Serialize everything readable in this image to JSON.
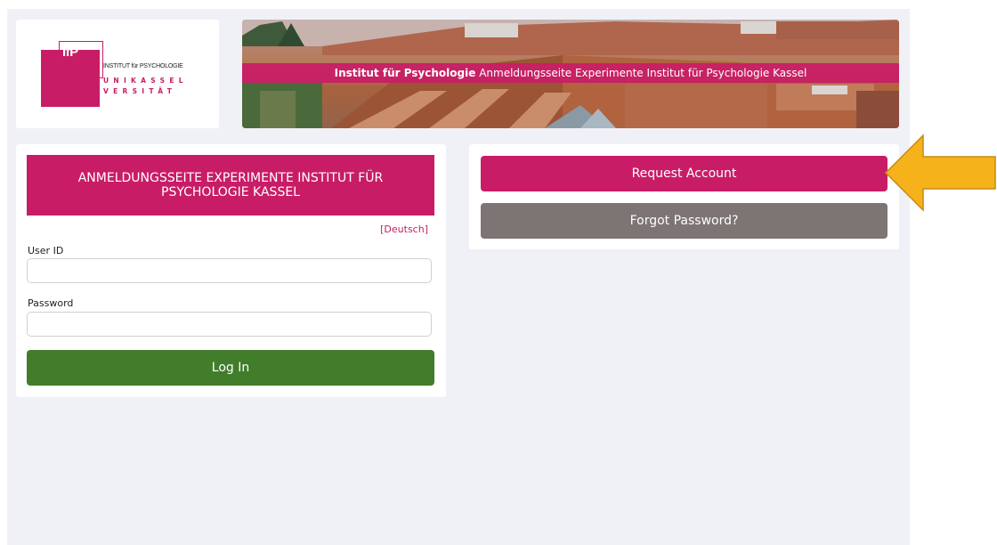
{
  "logo": {
    "mark": "IfP",
    "institute": "INSTITUT für PSYCHOLOGIE",
    "uni_line1": "UNIKASSEL",
    "uni_line2": "VERSITÄT"
  },
  "banner": {
    "title_bold": "Institut für Psychologie",
    "title_rest": "Anmeldungsseite Experimente Institut für Psychologie Kassel"
  },
  "login": {
    "header": "ANMELDUNGSSEITE EXPERIMENTE INSTITUT FÜR PSYCHOLOGIE KASSEL",
    "language_link": "[Deutsch]",
    "user_id_label": "User ID",
    "user_id_value": "",
    "password_label": "Password",
    "password_value": "",
    "login_button": "Log In"
  },
  "account": {
    "request_button": "Request Account",
    "forgot_button": "Forgot Password?"
  },
  "annotation": {
    "icon": "arrow-left-icon",
    "color": "#f5b21a"
  },
  "colors": {
    "brand": "#c81d66",
    "login_button": "#417d2b",
    "secondary_button": "#7c7573",
    "page_background": "#f0f1f6"
  }
}
